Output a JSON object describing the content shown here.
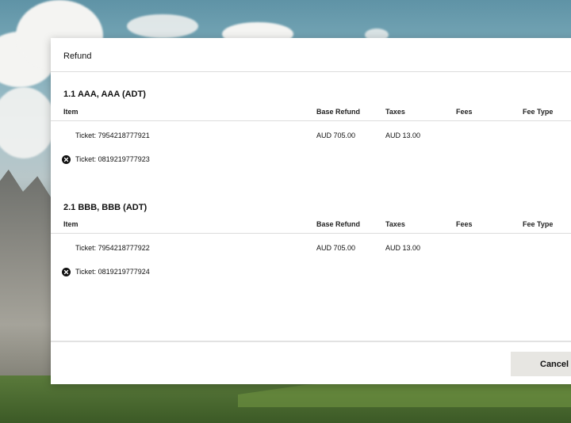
{
  "modal": {
    "title": "Refund",
    "columns": {
      "item": "Item",
      "base_refund": "Base Refund",
      "taxes": "Taxes",
      "fees": "Fees",
      "fee_type": "Fee Type"
    },
    "passengers": [
      {
        "title": "1.1 AAA, AAA (ADT)",
        "tickets": [
          {
            "label": "Ticket: 7954218777921",
            "base_refund": "AUD 705.00",
            "taxes": "AUD 13.00",
            "fees": "",
            "fee_type": "",
            "icon": ""
          },
          {
            "label": "Ticket: 0819219777923",
            "base_refund": "",
            "taxes": "",
            "fees": "",
            "fee_type": "",
            "icon": "close-circle-icon"
          }
        ]
      },
      {
        "title": "2.1 BBB, BBB (ADT)",
        "tickets": [
          {
            "label": "Ticket: 7954218777922",
            "base_refund": "AUD 705.00",
            "taxes": "AUD 13.00",
            "fees": "",
            "fee_type": "",
            "icon": ""
          },
          {
            "label": "Ticket: 0819219777924",
            "base_refund": "",
            "taxes": "",
            "fees": "",
            "fee_type": "",
            "icon": "close-circle-icon"
          }
        ]
      }
    ],
    "footer": {
      "cancel_label": "Cancel"
    }
  },
  "colors": {
    "modal_bg": "#ffffff",
    "divider": "#dcdcdc",
    "button_bg": "#e7e6e2",
    "icon": "#111111"
  }
}
